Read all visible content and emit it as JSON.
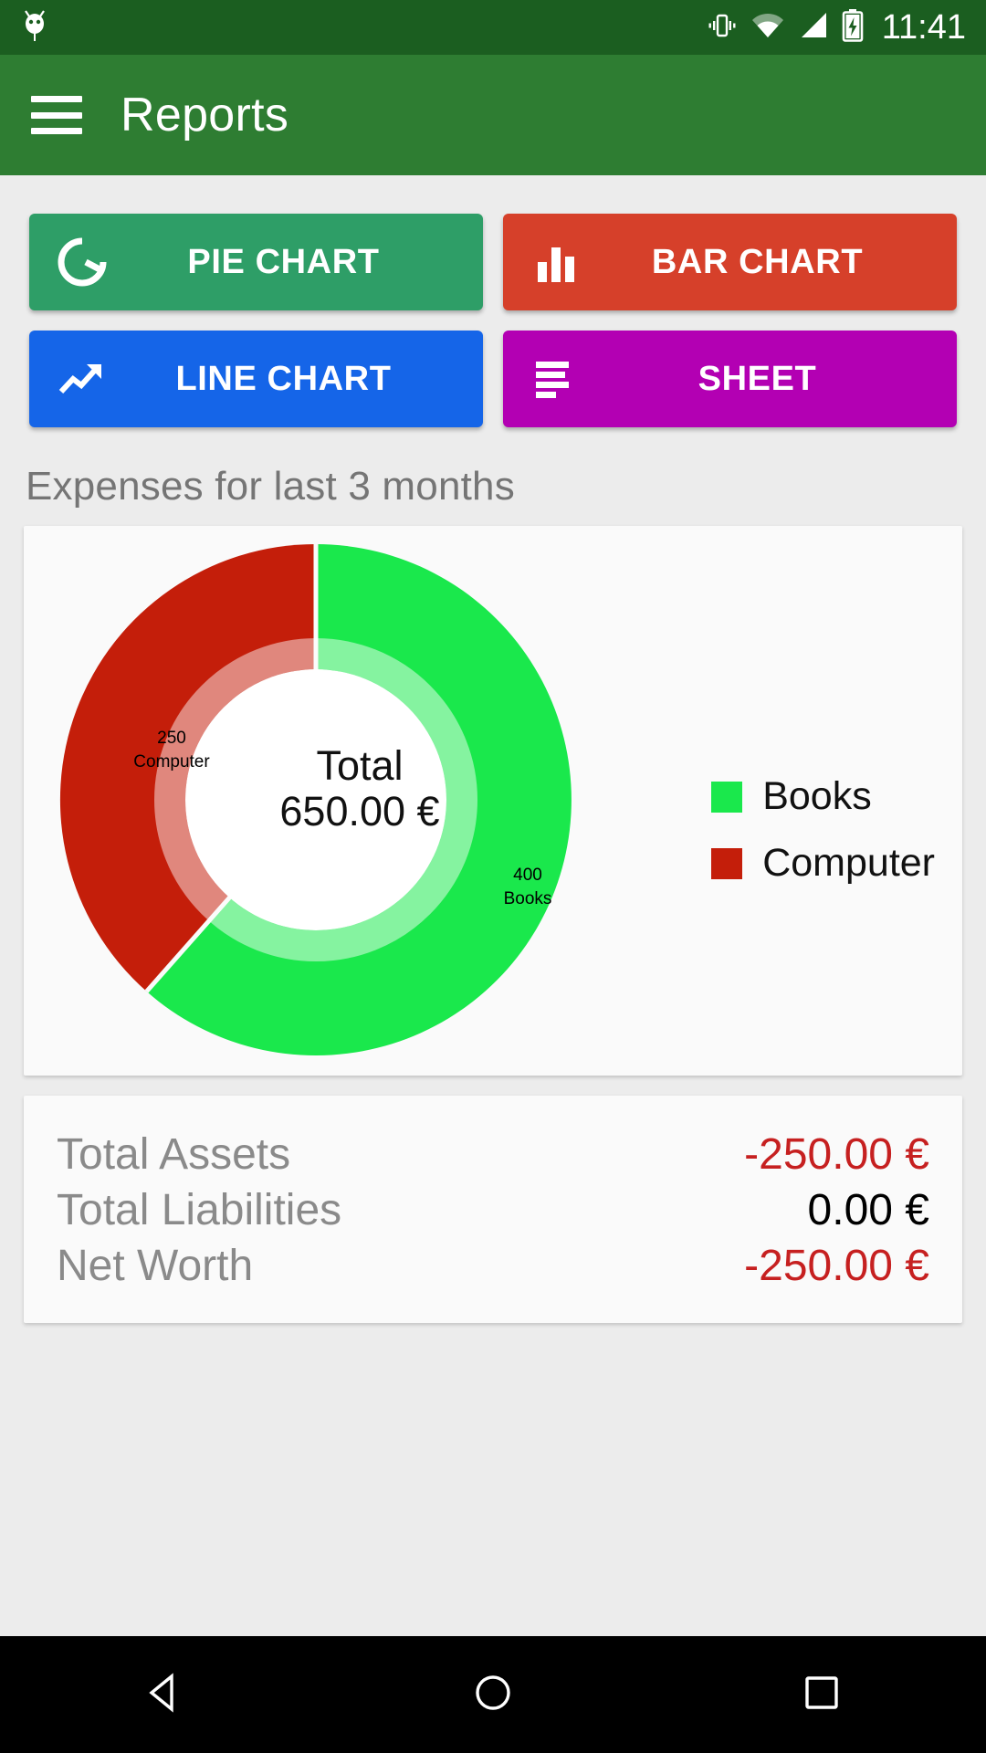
{
  "status_bar": {
    "time": "11:41",
    "icons": [
      "android-bug-icon",
      "vibrate-icon",
      "wifi-icon",
      "signal-icon",
      "battery-charging-icon"
    ],
    "background": "#1B5E20"
  },
  "app_bar": {
    "title": "Reports",
    "menu_icon": "hamburger-menu-icon",
    "background": "#2E7D32"
  },
  "report_buttons": [
    {
      "label": "PIE CHART",
      "icon": "pie-chart-icon",
      "color": "#2E9E67"
    },
    {
      "label": "BAR CHART",
      "icon": "bar-chart-icon",
      "color": "#D6402A"
    },
    {
      "label": "LINE CHART",
      "icon": "line-chart-icon",
      "color": "#1565E8"
    },
    {
      "label": "SHEET",
      "icon": "sheet-list-icon",
      "color": "#B300B3"
    }
  ],
  "section": {
    "title": "Expenses for last 3 months"
  },
  "chart_data": {
    "type": "pie",
    "title": "Expenses for last 3 months",
    "categories": [
      "Books",
      "Computer"
    ],
    "values": [
      400,
      250
    ],
    "labels": [
      {
        "value": "400",
        "name": "Books"
      },
      {
        "value": "250",
        "name": "Computer"
      }
    ],
    "colors": [
      "#1AE84C",
      "#C41E0A"
    ],
    "total_label": "Total",
    "total_value": "650.00 €",
    "legend": [
      {
        "label": "Books",
        "color": "#1AE84C"
      },
      {
        "label": "Computer",
        "color": "#C41E0A"
      }
    ],
    "legend_position": "right",
    "donut": true
  },
  "summary": {
    "rows": [
      {
        "label": "Total Assets",
        "value": "-250.00 €",
        "color": "#C62020"
      },
      {
        "label": "Total Liabilities",
        "value": "0.00 €",
        "color": "#000000"
      },
      {
        "label": "Net Worth",
        "value": "-250.00 €",
        "color": "#C62020"
      }
    ]
  },
  "nav_bar": {
    "back": "back-triangle-icon",
    "home": "home-circle-icon",
    "recents": "recents-square-icon"
  }
}
